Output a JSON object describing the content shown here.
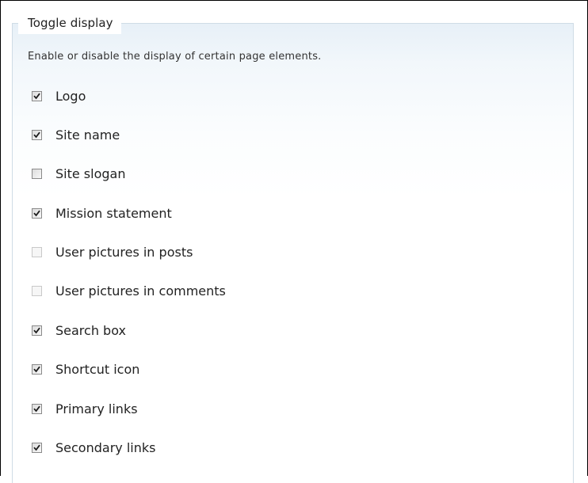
{
  "fieldset": {
    "legend": "Toggle display",
    "description": "Enable or disable the display of certain page elements."
  },
  "options": [
    {
      "label": "Logo",
      "checked": true,
      "enabled": true
    },
    {
      "label": "Site name",
      "checked": true,
      "enabled": true
    },
    {
      "label": "Site slogan",
      "checked": false,
      "enabled": true
    },
    {
      "label": "Mission statement",
      "checked": true,
      "enabled": true
    },
    {
      "label": "User pictures in posts",
      "checked": false,
      "enabled": false
    },
    {
      "label": "User pictures in comments",
      "checked": false,
      "enabled": false
    },
    {
      "label": "Search box",
      "checked": true,
      "enabled": true
    },
    {
      "label": "Shortcut icon",
      "checked": true,
      "enabled": true
    },
    {
      "label": "Primary links",
      "checked": true,
      "enabled": true
    },
    {
      "label": "Secondary links",
      "checked": true,
      "enabled": true
    }
  ]
}
